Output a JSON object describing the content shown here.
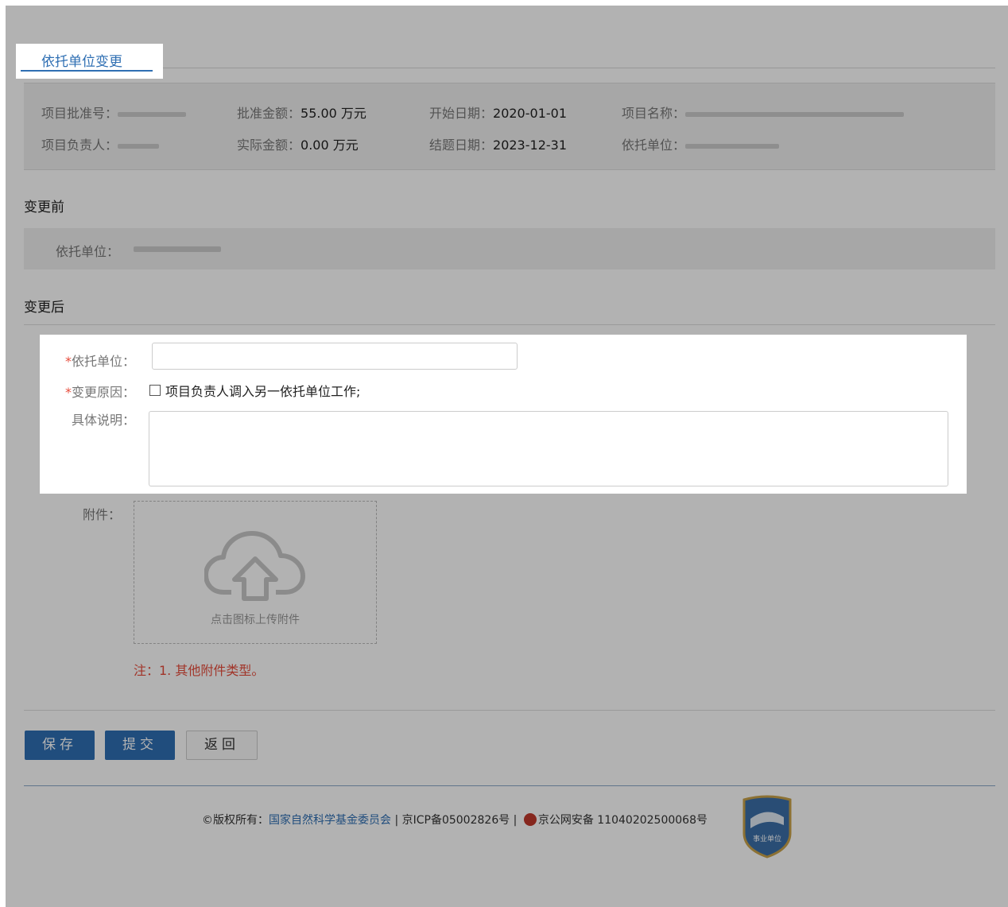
{
  "tab": {
    "label": "依托单位变更"
  },
  "info": {
    "approval_no_label": "项目批准号：",
    "approved_amount_label": "批准金额：",
    "approved_amount_value": "55.00 万元",
    "start_date_label": "开始日期：",
    "start_date_value": "2020-01-01",
    "project_name_label": "项目名称：",
    "leader_label": "项目负责人：",
    "actual_amount_label": "实际金额：",
    "actual_amount_value": "0.00 万元",
    "end_date_label": "结题日期：",
    "end_date_value": "2023-12-31",
    "unit_label": "依托单位："
  },
  "before": {
    "title": "变更前",
    "unit_label": "依托单位："
  },
  "after": {
    "title": "变更后",
    "required_mark": "*",
    "unit_label": "依托单位：",
    "reason_label": "变更原因：",
    "reason_option": "项目负责人调入另一依托单位工作;",
    "detail_label": "具体说明："
  },
  "attachment": {
    "label": "附件：",
    "hint": "点击图标上传附件",
    "note": "注：1. 其他附件类型。"
  },
  "buttons": {
    "save": "保存",
    "submit": "提交",
    "back": "返回"
  },
  "footer": {
    "copyright_prefix": "©版权所有：",
    "org": "国家自然科学基金委员会",
    "icp": " | 京ICP备05002826号 | ",
    "police": "京公网安备 11040202500068号",
    "badge_text": "事业单位"
  },
  "colors": {
    "accent": "#2f6fb3",
    "required": "#e74c3c"
  }
}
